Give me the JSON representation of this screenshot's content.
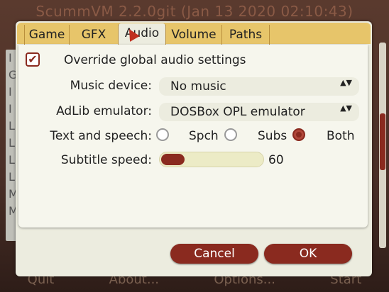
{
  "launcher": {
    "title": "ScummVM 2.2.0git (Jan 13 2020 02:10:43)",
    "list_letters": [
      "I",
      "G",
      "I",
      "I",
      "L",
      "L",
      "L",
      "L",
      "M",
      "M"
    ],
    "bottom_buttons": [
      "Quit",
      "About...",
      "Options...",
      "Start"
    ]
  },
  "tabs": [
    {
      "label": "Game"
    },
    {
      "label": "GFX"
    },
    {
      "label": "Audio"
    },
    {
      "label": "Volume"
    },
    {
      "label": "Paths"
    }
  ],
  "active_tab": "Audio",
  "audio": {
    "override_label": "Override global audio settings",
    "override_checked": true,
    "override_check_glyph": "✔",
    "music_device_label": "Music device:",
    "music_device_value": "No music",
    "adlib_label": "AdLib emulator:",
    "adlib_value": "DOSBox OPL emulator",
    "text_speech_label": "Text and speech:",
    "speech_options": [
      {
        "label": "Spch",
        "selected": false
      },
      {
        "label": "Subs",
        "selected": false
      },
      {
        "label": "Both",
        "selected": true
      }
    ],
    "subtitle_speed_label": "Subtitle speed:",
    "subtitle_speed_value": "60",
    "subtitle_speed_fraction": 0.23,
    "select_arrows": "▲▼"
  },
  "buttons": {
    "cancel": "Cancel",
    "ok": "OK"
  },
  "colors": {
    "accent": "#8a2a1f",
    "tabbar": "#e7c56a",
    "panel": "#f6f6ed"
  }
}
